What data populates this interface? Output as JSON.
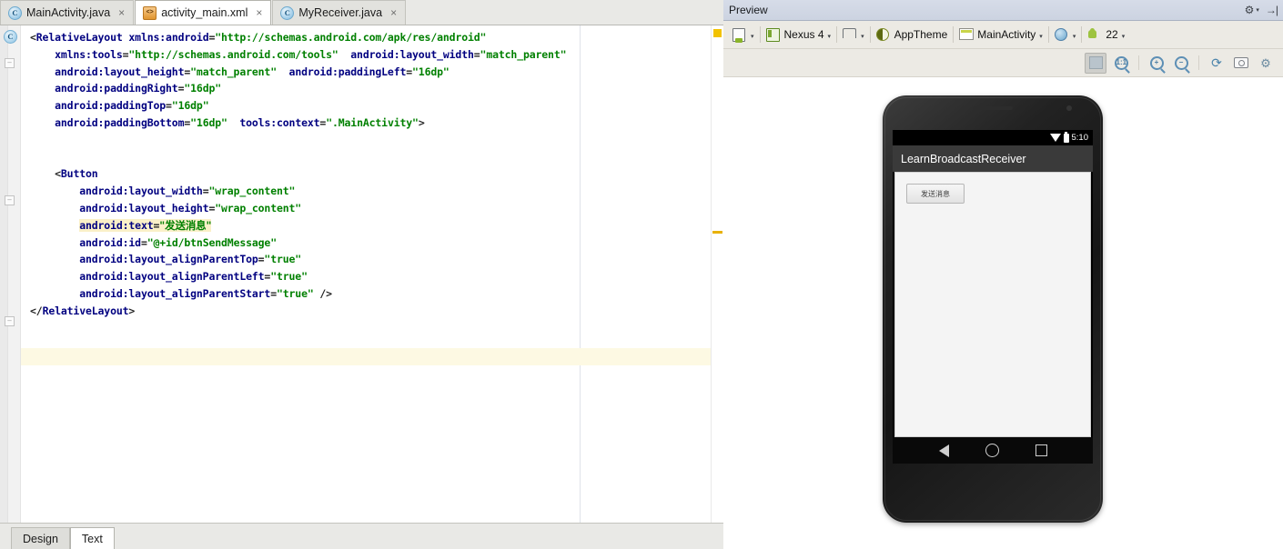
{
  "editor": {
    "tabs": [
      {
        "label": "MainActivity.java",
        "icon": "java-class-icon",
        "active": false,
        "close": "×"
      },
      {
        "label": "activity_main.xml",
        "icon": "xml-file-icon",
        "active": true,
        "close": "×"
      },
      {
        "label": "MyReceiver.java",
        "icon": "java-class-icon",
        "active": false,
        "close": "×"
      }
    ],
    "gutter_marker": "C",
    "bottom_tabs": [
      {
        "label": "Design",
        "active": false
      },
      {
        "label": "Text",
        "active": true
      }
    ],
    "code_lines": [
      {
        "indent": 0,
        "segments": [
          {
            "t": "<",
            "c": "punc"
          },
          {
            "t": "RelativeLayout",
            "c": "tagn"
          },
          {
            "t": " ",
            "c": "punc"
          },
          {
            "t": "xmlns:android",
            "c": "attr"
          },
          {
            "t": "=",
            "c": "punc"
          },
          {
            "t": "\"http://schemas.android.com/apk/res/android\"",
            "c": "val"
          }
        ]
      },
      {
        "indent": 1,
        "segments": [
          {
            "t": "xmlns:tools",
            "c": "attr"
          },
          {
            "t": "=",
            "c": "punc"
          },
          {
            "t": "\"http://schemas.android.com/tools\"",
            "c": "val"
          },
          {
            "t": "  ",
            "c": "punc"
          },
          {
            "t": "android:layout_width",
            "c": "attr"
          },
          {
            "t": "=",
            "c": "punc"
          },
          {
            "t": "\"match_parent\"",
            "c": "val"
          }
        ]
      },
      {
        "indent": 1,
        "segments": [
          {
            "t": "android:layout_height",
            "c": "attr"
          },
          {
            "t": "=",
            "c": "punc"
          },
          {
            "t": "\"match_parent\"",
            "c": "val"
          },
          {
            "t": "  ",
            "c": "punc"
          },
          {
            "t": "android:paddingLeft",
            "c": "attr"
          },
          {
            "t": "=",
            "c": "punc"
          },
          {
            "t": "\"16dp\"",
            "c": "val"
          }
        ]
      },
      {
        "indent": 1,
        "segments": [
          {
            "t": "android:paddingRight",
            "c": "attr"
          },
          {
            "t": "=",
            "c": "punc"
          },
          {
            "t": "\"16dp\"",
            "c": "val"
          }
        ]
      },
      {
        "indent": 1,
        "segments": [
          {
            "t": "android:paddingTop",
            "c": "attr"
          },
          {
            "t": "=",
            "c": "punc"
          },
          {
            "t": "\"16dp\"",
            "c": "val"
          }
        ]
      },
      {
        "indent": 1,
        "segments": [
          {
            "t": "android:paddingBottom",
            "c": "attr"
          },
          {
            "t": "=",
            "c": "punc"
          },
          {
            "t": "\"16dp\"",
            "c": "val"
          },
          {
            "t": "  ",
            "c": "punc"
          },
          {
            "t": "tools:context",
            "c": "attr"
          },
          {
            "t": "=",
            "c": "punc"
          },
          {
            "t": "\".MainActivity\"",
            "c": "val"
          },
          {
            "t": ">",
            "c": "punc"
          }
        ]
      },
      {
        "indent": 0,
        "segments": []
      },
      {
        "indent": 0,
        "segments": []
      },
      {
        "indent": 1,
        "segments": [
          {
            "t": "<",
            "c": "punc"
          },
          {
            "t": "Button",
            "c": "tagn"
          }
        ]
      },
      {
        "indent": 2,
        "segments": [
          {
            "t": "android:layout_width",
            "c": "attr"
          },
          {
            "t": "=",
            "c": "punc"
          },
          {
            "t": "\"wrap_content\"",
            "c": "val"
          }
        ]
      },
      {
        "indent": 2,
        "segments": [
          {
            "t": "android:layout_height",
            "c": "attr"
          },
          {
            "t": "=",
            "c": "punc"
          },
          {
            "t": "\"wrap_content\"",
            "c": "val"
          }
        ]
      },
      {
        "indent": 2,
        "highlight": true,
        "segments": [
          {
            "t": "android:text",
            "c": "attr"
          },
          {
            "t": "=",
            "c": "punc"
          },
          {
            "t": "\"发送消息\"",
            "c": "val cjk"
          }
        ]
      },
      {
        "indent": 2,
        "segments": [
          {
            "t": "android:id",
            "c": "attr"
          },
          {
            "t": "=",
            "c": "punc"
          },
          {
            "t": "\"@+id/btnSendMessage\"",
            "c": "val"
          }
        ]
      },
      {
        "indent": 2,
        "segments": [
          {
            "t": "android:layout_alignParentTop",
            "c": "attr"
          },
          {
            "t": "=",
            "c": "punc"
          },
          {
            "t": "\"true\"",
            "c": "val"
          }
        ]
      },
      {
        "indent": 2,
        "segments": [
          {
            "t": "android:layout_alignParentLeft",
            "c": "attr"
          },
          {
            "t": "=",
            "c": "punc"
          },
          {
            "t": "\"true\"",
            "c": "val"
          }
        ]
      },
      {
        "indent": 2,
        "segments": [
          {
            "t": "android:layout_alignParentStart",
            "c": "attr"
          },
          {
            "t": "=",
            "c": "punc"
          },
          {
            "t": "\"true\"",
            "c": "val"
          },
          {
            "t": " />",
            "c": "punc"
          }
        ]
      },
      {
        "indent": 0,
        "segments": [
          {
            "t": "</",
            "c": "punc"
          },
          {
            "t": "RelativeLayout",
            "c": "tagn"
          },
          {
            "t": ">",
            "c": "punc"
          }
        ]
      }
    ]
  },
  "preview": {
    "title": "Preview",
    "settings_icon": "gear-icon",
    "settings_caret": "▾",
    "collapse_icon": "→|",
    "toolbar": [
      {
        "label": "",
        "icon": "device-configuration-icon",
        "caret": "▾"
      },
      {
        "label": "Nexus 4",
        "icon": "device-icon",
        "caret": "▾"
      },
      {
        "label": "",
        "icon": "orientation-icon",
        "caret": "▾"
      },
      {
        "label": "AppTheme",
        "icon": "theme-icon",
        "caret": ""
      },
      {
        "label": "MainActivity",
        "icon": "activity-icon",
        "caret": "▾"
      },
      {
        "label": "",
        "icon": "locale-icon",
        "caret": "▾"
      },
      {
        "label": "22",
        "icon": "android-api-icon",
        "caret": "▾"
      }
    ],
    "zoom_tools": [
      {
        "icon": "zoom-fit-icon",
        "pressed": true
      },
      {
        "icon": "zoom-actual-size-icon",
        "label": "1:1"
      },
      {
        "icon": "zoom-in-icon",
        "label": "+"
      },
      {
        "icon": "zoom-out-icon",
        "label": "−"
      },
      {
        "icon": "refresh-icon",
        "label": "⟳"
      },
      {
        "icon": "screenshot-icon"
      },
      {
        "icon": "preview-settings-icon"
      }
    ],
    "device": {
      "name": "Nexus 4",
      "status_time": "5:10",
      "wifi_icon": "wifi-icon",
      "battery_icon": "battery-icon",
      "app_title": "LearnBroadcastReceiver",
      "button_text": "发送消息",
      "nav": [
        {
          "icon": "nav-back-icon"
        },
        {
          "icon": "nav-home-icon"
        },
        {
          "icon": "nav-recents-icon"
        }
      ]
    }
  },
  "colors": {
    "xml_tag": "#000080",
    "xml_value": "#008000",
    "highlight": "#faf0c8",
    "caret_line": "#fdf9e3",
    "warn_marker": "#f2c200",
    "appbar": "#3a3a3a"
  }
}
